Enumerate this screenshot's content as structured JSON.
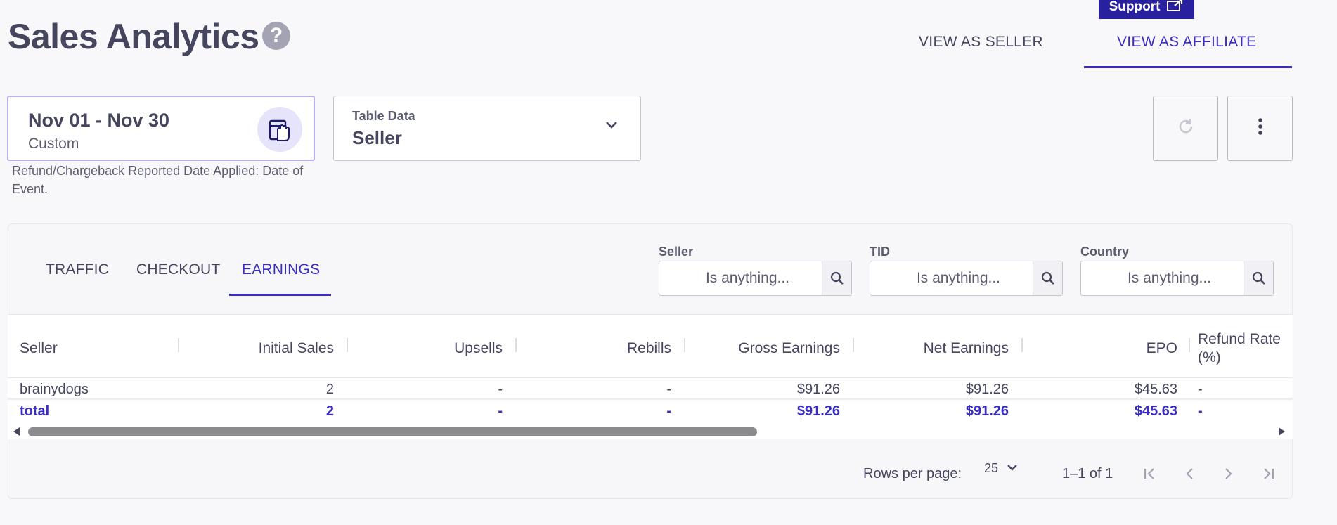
{
  "header": {
    "title": "Sales Analytics",
    "help_icon": "?",
    "support_label": "Support",
    "view_tabs": [
      {
        "label": "VIEW AS SELLER",
        "active": false
      },
      {
        "label": "VIEW AS AFFILIATE",
        "active": true
      }
    ]
  },
  "date_picker": {
    "range": "Nov 01 - Nov 30",
    "preset": "Custom",
    "note": "Refund/Chargeback Reported Date Applied: Date of Event.",
    "icon": "calendar-hand-icon"
  },
  "table_data_select": {
    "label": "Table Data",
    "value": "Seller"
  },
  "sub_tabs": [
    {
      "label": "TRAFFIC",
      "active": false
    },
    {
      "label": "CHECKOUT",
      "active": false
    },
    {
      "label": "EARNINGS",
      "active": true
    }
  ],
  "filters": [
    {
      "label": "Seller",
      "placeholder": "Is anything..."
    },
    {
      "label": "TID",
      "placeholder": "Is anything..."
    },
    {
      "label": "Country",
      "placeholder": "Is anything..."
    }
  ],
  "table": {
    "columns": [
      "Seller",
      "Initial Sales",
      "Upsells",
      "Rebills",
      "Gross Earnings",
      "Net Earnings",
      "EPO",
      "Refund Rate",
      "(%)"
    ],
    "rows": [
      [
        "brainydogs",
        "2",
        "-",
        "-",
        "$91.26",
        "$91.26",
        "$45.63",
        "-"
      ]
    ],
    "total": [
      "total",
      "2",
      "-",
      "-",
      "$91.26",
      "$91.26",
      "$45.63",
      "-"
    ]
  },
  "pagination": {
    "rows_per_page_label": "Rows per page:",
    "rows_per_page": "25",
    "range": "1–1 of 1"
  },
  "colors": {
    "accent": "#3a2dc3",
    "support_bg": "#28209e",
    "text": "#45465e"
  }
}
